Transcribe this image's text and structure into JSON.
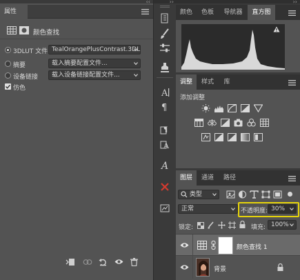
{
  "properties_panel": {
    "tab_title": "属性",
    "header_title": "颜色查找",
    "rows": [
      {
        "radio_label": "3DLUT 文件",
        "selected": true,
        "dropdown_value": "TealOrangePlusContrast.3DL"
      },
      {
        "radio_label": "摘要",
        "selected": false,
        "dropdown_value": "载入摘要配置文件..."
      },
      {
        "radio_label": "设备链接",
        "selected": false,
        "dropdown_value": "载入设备链接配置文件..."
      }
    ],
    "dither_label": "仿色",
    "dither_checked": true
  },
  "top_tabs": {
    "items": [
      "颜色",
      "色板",
      "导航器",
      "直方图"
    ],
    "active": "直方图"
  },
  "adjust_tabs": {
    "items": [
      "调整",
      "样式",
      "库"
    ],
    "active": "调整"
  },
  "adjust_panel": {
    "title": "添加调整"
  },
  "layers_tabs": {
    "items": [
      "图层",
      "通道",
      "路径"
    ],
    "active": "图层"
  },
  "layers_panel": {
    "filter_kind": "类型",
    "blend_mode": "正常",
    "opacity_label": "不透明度:",
    "opacity_value": "30%",
    "lock_label": "锁定:",
    "fill_label": "填充:",
    "fill_value": "100%",
    "layers": [
      {
        "name": "颜色查找 1",
        "type": "adjustment",
        "visible": true,
        "selected": true
      },
      {
        "name": "背景",
        "type": "background",
        "visible": true,
        "selected": false,
        "locked": true
      }
    ]
  },
  "colors": {
    "highlight_border": "#e6d40a",
    "panel_bg": "#535353",
    "dark_bg": "#3a3a3a",
    "selected_layer": "#6a6a6a",
    "cancel_red": "#d43a2f"
  }
}
